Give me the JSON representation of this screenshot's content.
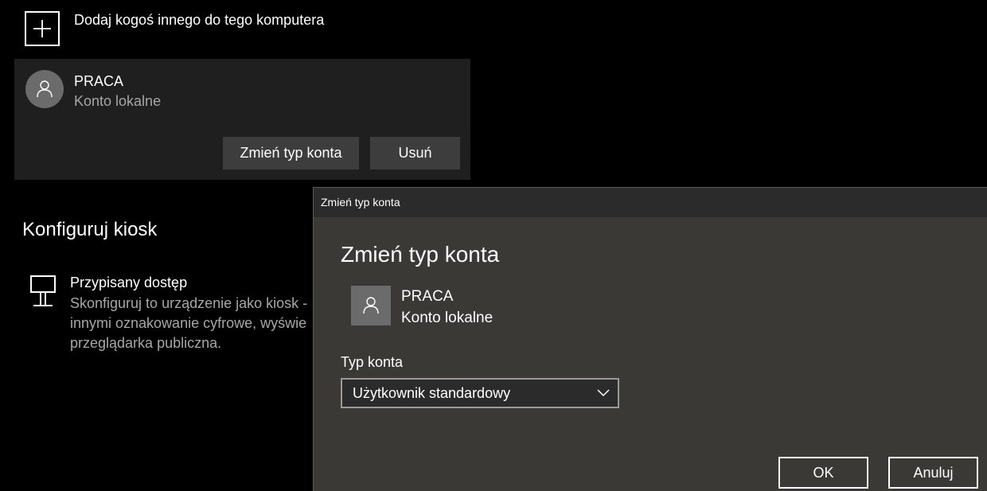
{
  "add_user": {
    "label": "Dodaj kogoś innego do tego komputera",
    "icon": "plus-icon"
  },
  "account_card": {
    "name": "PRACA",
    "type": "Konto lokalne",
    "change_button": "Zmień typ konta",
    "remove_button": "Usuń",
    "avatar_icon": "person-icon"
  },
  "kiosk": {
    "title": "Konfiguruj kiosk",
    "item_title": "Przypisany dostęp",
    "item_desc": "Skonfiguruj to urządzenie jako kiosk -\ninnymi oznakowanie cyfrowe, wyświe\nprzeglądarka publiczna.",
    "icon": "kiosk-icon"
  },
  "dialog": {
    "window_title": "Zmień typ konta",
    "heading": "Zmień typ konta",
    "account_name": "PRACA",
    "account_type": "Konto lokalne",
    "field_label": "Typ konta",
    "selected_value": "Użytkownik standardowy",
    "ok_button": "OK",
    "cancel_button": "Anuluj"
  },
  "colors": {
    "background": "#000000",
    "card": "#1f1f1f",
    "dialog": "#3b3935",
    "button": "#3d3d3d",
    "avatar": "#6b6b6b",
    "secondary_text": "#a6a6a6"
  }
}
